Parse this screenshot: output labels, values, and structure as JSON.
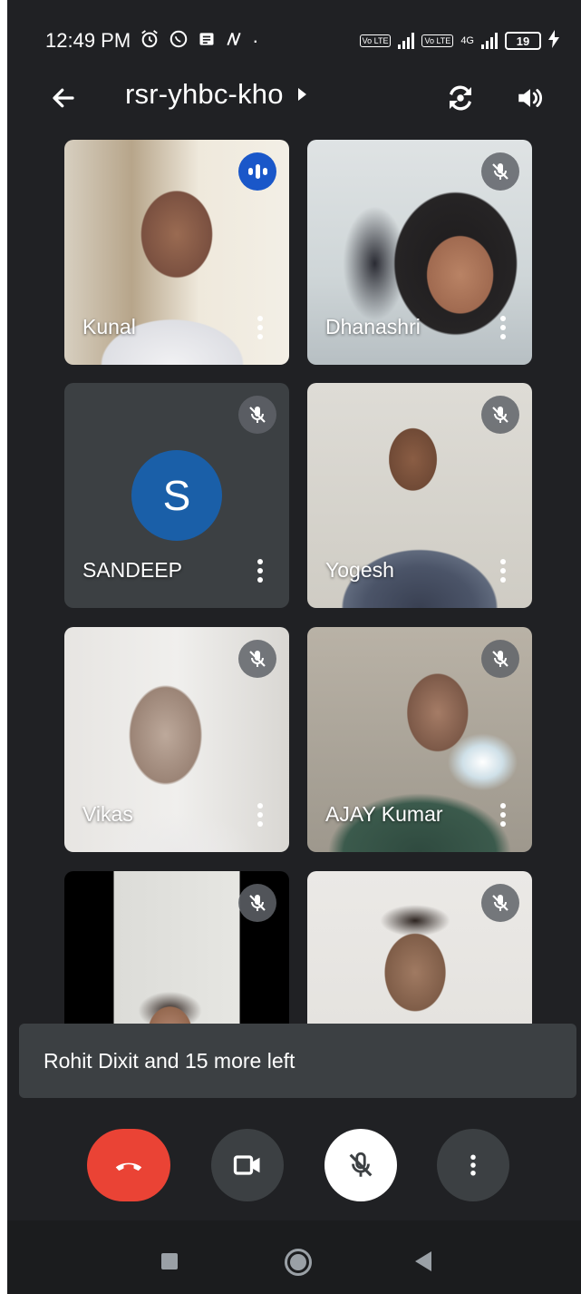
{
  "status_bar": {
    "time": "12:49 PM",
    "icons": [
      "alarm-icon",
      "whatsapp-icon",
      "notification-icon",
      "n-icon"
    ],
    "dot": "·",
    "network_label": "4G",
    "volte_label": "Vo LTE",
    "battery": "19"
  },
  "header": {
    "meeting_code": "rsr-yhbc-kho",
    "icons": [
      "back-arrow-icon",
      "caret-right-icon",
      "flip-camera-icon",
      "speaker-icon"
    ]
  },
  "participants": [
    {
      "name": "Kunal",
      "state": "speaking"
    },
    {
      "name": "Dhanashri",
      "state": "muted"
    },
    {
      "name": "SANDEEP",
      "state": "muted",
      "avatar_letter": "S",
      "avatar_color": "#1a5fa8"
    },
    {
      "name": "Yogesh",
      "state": "muted"
    },
    {
      "name": "Vikas",
      "state": "muted"
    },
    {
      "name": "AJAY Kumar",
      "state": "muted"
    },
    {
      "name": "",
      "state": "muted"
    },
    {
      "name": "",
      "state": "muted"
    }
  ],
  "toast": {
    "message": "Rohit Dixit and 15 more left"
  },
  "controls": {
    "colors": {
      "end_call": "#ea4335",
      "dark": "#3c4043",
      "mic_active_bg": "#ffffff"
    }
  }
}
